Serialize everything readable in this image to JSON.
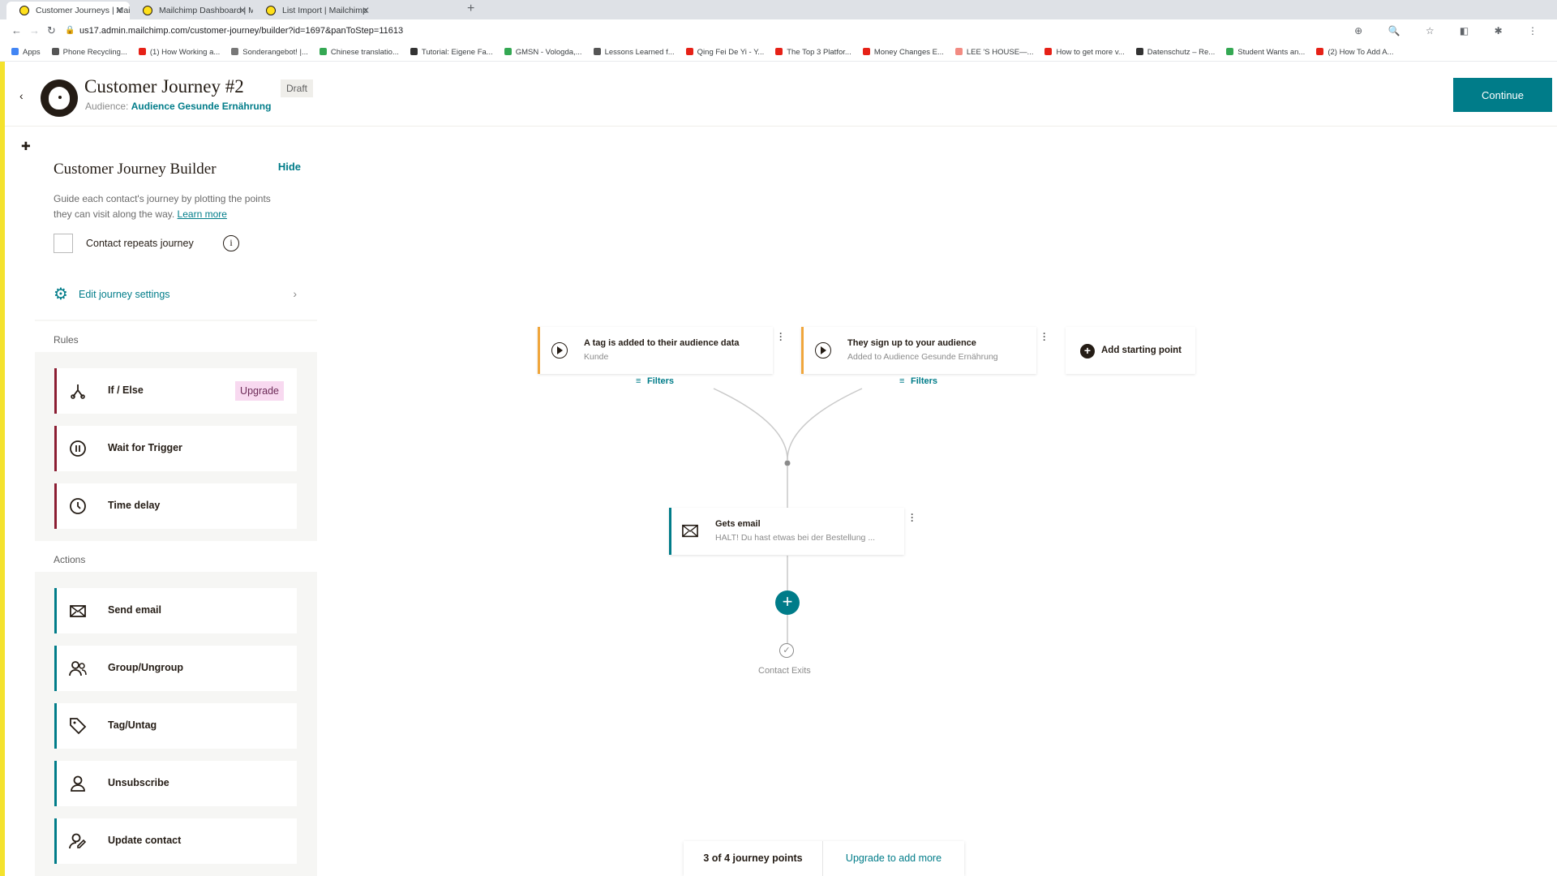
{
  "browser": {
    "tabs": [
      {
        "title": "Customer Journeys | Mailchim",
        "active": true
      },
      {
        "title": "Mailchimp Dashboard | Mailch",
        "active": false
      },
      {
        "title": "List Import | Mailchimp",
        "active": false
      }
    ],
    "url": "us17.admin.mailchimp.com/customer-journey/builder?id=1697&panToStep=11613",
    "bookmarks": [
      {
        "label": "Apps",
        "color": "#4285f4"
      },
      {
        "label": "Phone Recycling...",
        "color": "#555555"
      },
      {
        "label": "(1) How Working a...",
        "color": "#e62117"
      },
      {
        "label": "Sonderangebot! |...",
        "color": "#777777"
      },
      {
        "label": "Chinese translatio...",
        "color": "#34a853"
      },
      {
        "label": "Tutorial: Eigene Fa...",
        "color": "#333333"
      },
      {
        "label": "GMSN - Vologda,...",
        "color": "#34a853"
      },
      {
        "label": "Lessons Learned f...",
        "color": "#555555"
      },
      {
        "label": "Qing Fei De Yi - Y...",
        "color": "#e62117"
      },
      {
        "label": "The Top 3 Platfor...",
        "color": "#e62117"
      },
      {
        "label": "Money Changes E...",
        "color": "#e62117"
      },
      {
        "label": "LEE 'S HOUSE—...",
        "color": "#f28b82"
      },
      {
        "label": "How to get more v...",
        "color": "#e62117"
      },
      {
        "label": "Datenschutz – Re...",
        "color": "#333333"
      },
      {
        "label": "Student Wants an...",
        "color": "#34a853"
      },
      {
        "label": "(2) How To Add A...",
        "color": "#e62117"
      }
    ]
  },
  "header": {
    "title": "Customer Journey #2",
    "status": "Draft",
    "audience_prefix": "Audience:",
    "audience_name": "Audience Gesunde Ernährung",
    "continue_label": "Continue"
  },
  "sidebar": {
    "title": "Customer Journey Builder",
    "hide_label": "Hide",
    "description": "Guide each contact's journey by plotting the points they can visit along the way.",
    "learn_more": "Learn more",
    "repeat_label": "Contact repeats journey",
    "settings_label": "Edit journey settings",
    "rules_heading": "Rules",
    "rules": [
      {
        "label": "If / Else",
        "icon": "branch-icon",
        "badge": "Upgrade"
      },
      {
        "label": "Wait for Trigger",
        "icon": "pause-icon"
      },
      {
        "label": "Time delay",
        "icon": "clock-icon"
      }
    ],
    "actions_heading": "Actions",
    "actions": [
      {
        "label": "Send email",
        "icon": "envelope-icon"
      },
      {
        "label": "Group/Ungroup",
        "icon": "group-icon"
      },
      {
        "label": "Tag/Untag",
        "icon": "tag-icon"
      },
      {
        "label": "Unsubscribe",
        "icon": "unsubscribe-icon"
      },
      {
        "label": "Update contact",
        "icon": "update-contact-icon"
      }
    ]
  },
  "canvas": {
    "starting_points": [
      {
        "title": "A tag is added to their audience data",
        "subtitle": "Kunde",
        "filters_label": "Filters"
      },
      {
        "title": "They sign up to your audience",
        "subtitle": "Added to Audience Gesunde Ernährung",
        "filters_label": "Filters"
      }
    ],
    "add_starting_point": "Add starting point",
    "email_step": {
      "title": "Gets email",
      "subtitle": "HALT! Du hast etwas bei der Bestellung ..."
    },
    "exit_label": "Contact Exits",
    "footer": {
      "points": "3 of 4 journey points",
      "upgrade": "Upgrade to add more"
    }
  },
  "colors": {
    "accent": "#007c89",
    "rule_border": "#8b1d32",
    "trigger_border": "#f0a63c",
    "upgrade_bg": "#f8d9f0"
  }
}
